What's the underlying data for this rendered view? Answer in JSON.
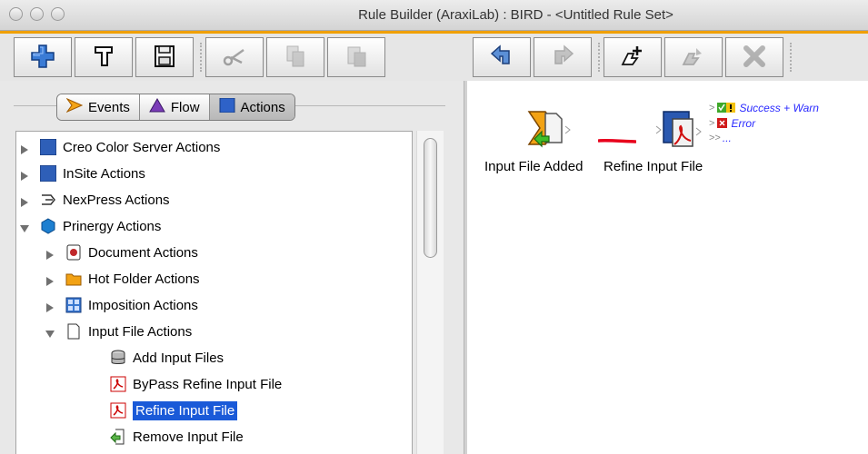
{
  "window": {
    "title": "Rule Builder (AraxiLab) : BIRD - <Untitled Rule Set>"
  },
  "toolbar": {
    "buttons": [
      {
        "name": "add",
        "icon": "plus-icon",
        "enabled": true
      },
      {
        "name": "properties",
        "icon": "hammer-icon",
        "enabled": true
      },
      {
        "name": "save",
        "icon": "save-icon",
        "enabled": true
      },
      {
        "name": "cut",
        "icon": "scissors-icon",
        "enabled": false
      },
      {
        "name": "copy",
        "icon": "copy-icon",
        "enabled": false
      },
      {
        "name": "paste",
        "icon": "paste-icon",
        "enabled": false
      },
      {
        "name": "undo",
        "icon": "undo-arrow-icon",
        "enabled": true
      },
      {
        "name": "redo",
        "icon": "redo-arrow-icon",
        "enabled": false
      },
      {
        "name": "new-rule",
        "icon": "new-rule-icon",
        "enabled": true
      },
      {
        "name": "rule-alt",
        "icon": "rule-icon",
        "enabled": false
      },
      {
        "name": "delete",
        "icon": "delete-x-icon",
        "enabled": false
      }
    ]
  },
  "tabs": [
    {
      "label": "Events",
      "icon": "events-arrow-icon"
    },
    {
      "label": "Flow",
      "icon": "flow-triangle-icon"
    },
    {
      "label": "Actions",
      "icon": "actions-square-icon",
      "active": true
    }
  ],
  "tree": {
    "items": [
      {
        "label": "Creo Color Server Actions",
        "expanded": false,
        "icon": "blue-square-icon"
      },
      {
        "label": "InSite Actions",
        "expanded": false,
        "icon": "blue-square-icon"
      },
      {
        "label": "NexPress Actions",
        "expanded": false,
        "icon": "nexpress-icon"
      },
      {
        "label": "Prinergy Actions",
        "expanded": true,
        "icon": "prinergy-hexagon-icon"
      },
      {
        "label": "Document Actions",
        "expanded": false,
        "icon": "document-icon"
      },
      {
        "label": "Hot Folder Actions",
        "expanded": false,
        "icon": "folder-icon"
      },
      {
        "label": "Imposition Actions",
        "expanded": false,
        "icon": "imposition-grid-icon"
      },
      {
        "label": "Input File Actions",
        "expanded": true,
        "icon": "page-icon"
      },
      {
        "label": "Add Input Files",
        "icon": "database-icon"
      },
      {
        "label": "ByPass Refine Input File",
        "icon": "pdf-icon"
      },
      {
        "label": "Refine Input File",
        "icon": "pdf-icon",
        "selected": true
      },
      {
        "label": "Remove Input File",
        "icon": "remove-file-icon"
      }
    ]
  },
  "canvas": {
    "nodes": [
      {
        "label": "Input File Added",
        "icon": "input-file-added-icon"
      },
      {
        "label": "Refine Input File",
        "icon": "refine-input-file-icon"
      }
    ],
    "outputs": [
      {
        "label": "Success + Warn",
        "icon": "success-warn-icon"
      },
      {
        "label": "Error",
        "icon": "error-icon"
      },
      {
        "label": "...",
        "icon": "more-outputs-icon"
      }
    ],
    "colors": {
      "link": "#e8001c",
      "output_text": "#2a2aff",
      "selection": "#1a5ad8"
    }
  }
}
